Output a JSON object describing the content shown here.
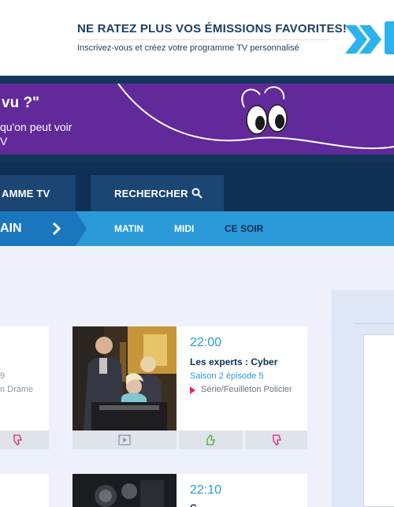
{
  "promo": {
    "title": "NE RATEZ PLUS VOS ÉMISSIONS FAVORITES!",
    "subtitle": "Inscrivez-vous et créez votre programme TV personnalisé"
  },
  "hero": {
    "title": "vu ?\"",
    "subtitle": "qu'on peut voir\nV"
  },
  "nav": {
    "programme_label": "AMME TV",
    "search_label": "RECHERCHER"
  },
  "subnav": {
    "day_label": "AIN",
    "items": [
      "MATIN",
      "MIDI",
      "CE SOIR"
    ]
  },
  "cards": [
    {
      "time": "22:00",
      "title": "Les experts : Cyber",
      "season": "Saison 2 épisode 5",
      "genre": "Série/Feuilleton Policier"
    },
    {
      "time": "22:10",
      "title": "C"
    }
  ],
  "partial_card": {
    "line1": "9",
    "line2": "n Drame"
  },
  "colors": {
    "brand_navy": "#0f2f55",
    "accent_blue": "#2b9ad9",
    "purple": "#62299a",
    "genre_pink": "#e0227a"
  }
}
